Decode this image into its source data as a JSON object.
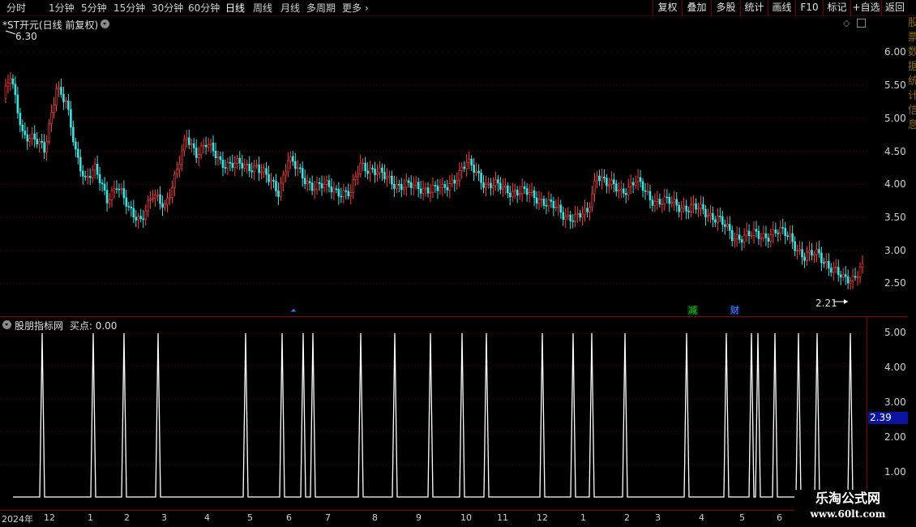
{
  "toolbar": {
    "periods": [
      "分时",
      "1分钟",
      "5分钟",
      "15分钟",
      "30分钟",
      "60分钟",
      "日线",
      "周线",
      "月线",
      "多周期",
      "更多"
    ],
    "active_period": "日线",
    "tools": [
      "复权",
      "叠加",
      "多股",
      "统计",
      "画线",
      "F10",
      "标记",
      "+自选",
      "返回"
    ]
  },
  "main_chart": {
    "title": "*ST开元(日线 前复权)",
    "high_label": "6.30",
    "low_label": "2.21",
    "y_ticks": [
      "6.00",
      "5.50",
      "5.00",
      "4.50",
      "4.00",
      "3.50",
      "3.00",
      "2.50"
    ],
    "event_markers": [
      {
        "text": "减",
        "color": "#20c020"
      },
      {
        "text": "财",
        "color": "#4080ff"
      }
    ],
    "colors": {
      "up": "#ff4040",
      "down": "#40e0e0",
      "grid": "#5a0000"
    }
  },
  "indicator": {
    "name": "股朋指标网",
    "field_label": "买点:",
    "field_value": "0.00",
    "y_ticks": [
      "5.00",
      "4.00",
      "3.00",
      "2.00",
      "1.00"
    ],
    "current_value": "2.39",
    "line_color": "#ffffff"
  },
  "x_axis": {
    "labels": [
      "2024年",
      "12",
      "1",
      "2",
      "3",
      "4",
      "5",
      "6",
      "7",
      "8",
      "9",
      "10",
      "11",
      "12",
      "1",
      "2",
      "3",
      "4",
      "5",
      "6"
    ]
  },
  "watermark": {
    "line1": "乐淘公式网",
    "line2": "www.60lt.com"
  },
  "right_strip_text": "股票数据统计信息"
}
